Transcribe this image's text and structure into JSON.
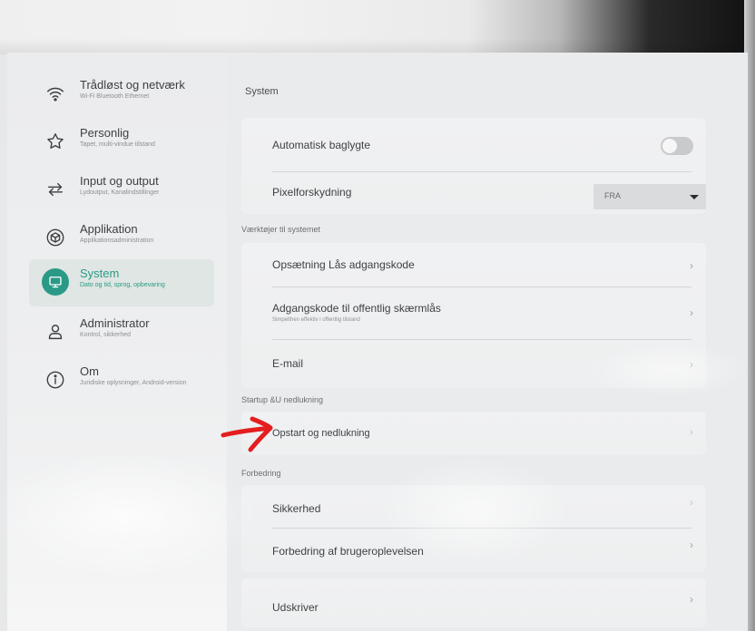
{
  "sidebar": {
    "items": [
      {
        "label": "Trådløst og netværk",
        "sub": "Wi-Fi Bluetooth Ethernet",
        "icon": "wifi-icon"
      },
      {
        "label": "Personlig",
        "sub": "Tapet, multi-vindue tilstand",
        "icon": "star-icon"
      },
      {
        "label": "Input og output",
        "sub": "Lydoutput, Kanalindstillinger",
        "icon": "swap-arrows-icon"
      },
      {
        "label": "Applikation",
        "sub": "Applikationsadministration",
        "icon": "cube-icon"
      },
      {
        "label": "System",
        "sub": "Dato og tid, sprog, opbevaring",
        "icon": "monitor-icon",
        "active": true
      },
      {
        "label": "Administrator",
        "sub": "Kontrol, sikkerhed",
        "icon": "user-icon"
      },
      {
        "label": "Om",
        "sub": "Juridiske oplysninger, Android-version",
        "icon": "info-icon"
      }
    ]
  },
  "main": {
    "title": "System",
    "display": {
      "auto_backlight_label": "Automatisk baglygte",
      "auto_backlight_on": false,
      "pixel_shift_label": "Pixelforskydning",
      "pixel_shift_value": "FRA"
    },
    "sections": {
      "tools": "Værktøjer til systemet",
      "startup": "Startup &U nedlukning",
      "improvement": "Forbedring"
    },
    "tools": {
      "lock_password_setup": "Opsætning Lås adgangskode",
      "public_lock_label": "Adgangskode til offentlig skærmlås",
      "public_lock_sub": "Simpelthen effektiv i offentlig tilstand",
      "email": "E-mail"
    },
    "startup": {
      "startup_shutdown": "Opstart og nedlukning"
    },
    "improvement": {
      "security": "Sikkerhed",
      "user_experience": "Forbedring af brugeroplevelsen"
    },
    "printer": "Udskriver"
  },
  "chevron": "›",
  "colors": {
    "accent": "#2a9a86",
    "annotation_arrow": "#e41e1e"
  }
}
